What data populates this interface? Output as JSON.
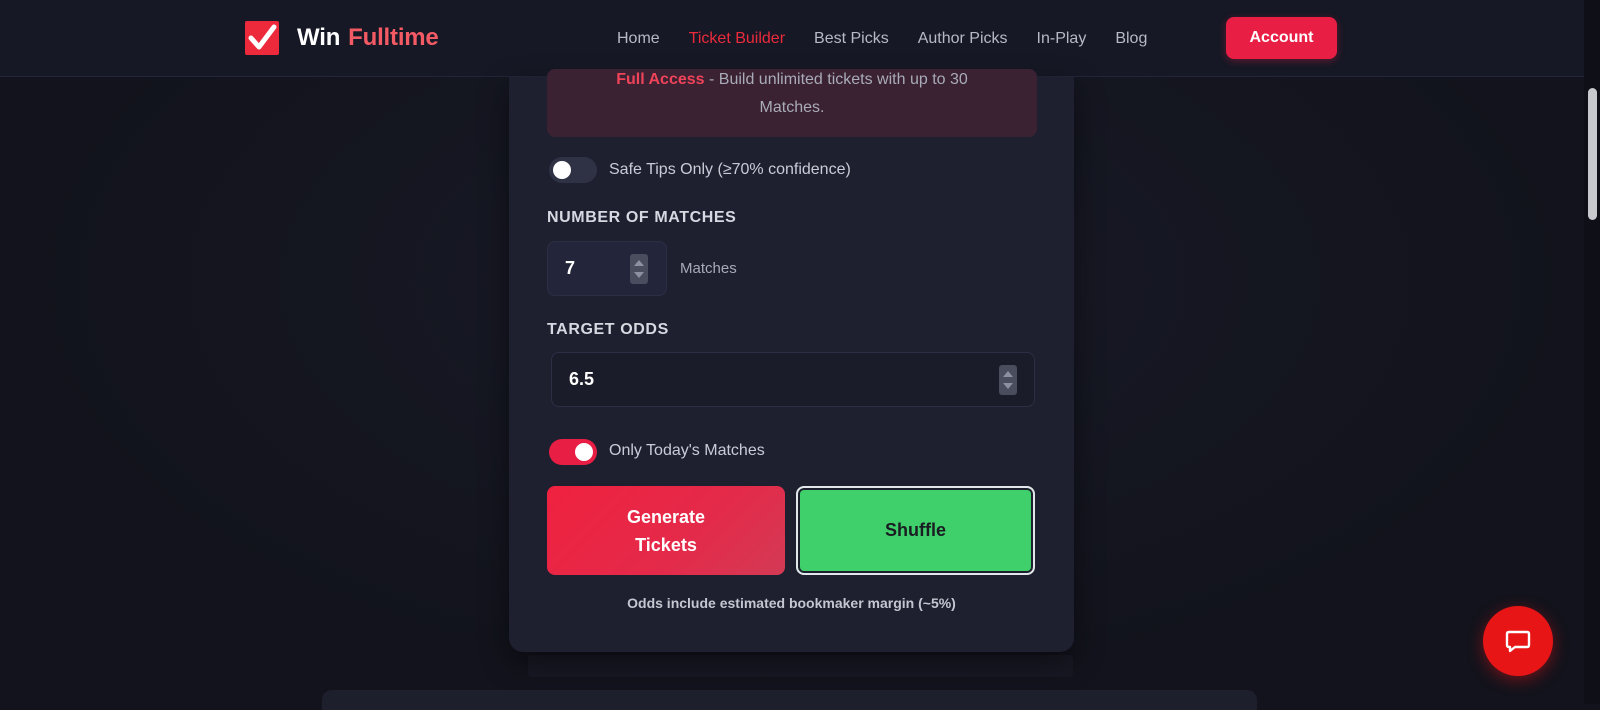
{
  "brand": {
    "word1": "Win",
    "word2": "Fulltime"
  },
  "nav": {
    "items": [
      {
        "label": "Home",
        "active": false
      },
      {
        "label": "Ticket Builder",
        "active": true
      },
      {
        "label": "Best Picks",
        "active": false
      },
      {
        "label": "Author Picks",
        "active": false
      },
      {
        "label": "In-Play",
        "active": false
      },
      {
        "label": "Blog",
        "active": false
      }
    ],
    "account_label": "Account"
  },
  "builder": {
    "notice": {
      "strong": "Full Access",
      "text_line1": " - Build unlimited tickets with up to 30",
      "text_line2": "Matches."
    },
    "safe_tips": {
      "label": "Safe Tips Only (≥70% confidence)",
      "on": false
    },
    "matches": {
      "title": "NUMBER OF MATCHES",
      "value": "7",
      "unit": "Matches"
    },
    "odds": {
      "title": "TARGET ODDS",
      "value": "6.5"
    },
    "today_only": {
      "label": "Only Today's Matches",
      "on": true
    },
    "generate_line1": "Generate",
    "generate_line2": "Tickets",
    "shuffle_label": "Shuffle",
    "footnote": "Odds include estimated bookmaker margin (~5%)"
  },
  "colors": {
    "accent": "#e91e45",
    "success": "#3fd06b",
    "background": "#12131c",
    "card": "#1e2030"
  },
  "icons": {
    "logo": "checkmark-icon",
    "chat": "chat-bubble-icon"
  }
}
